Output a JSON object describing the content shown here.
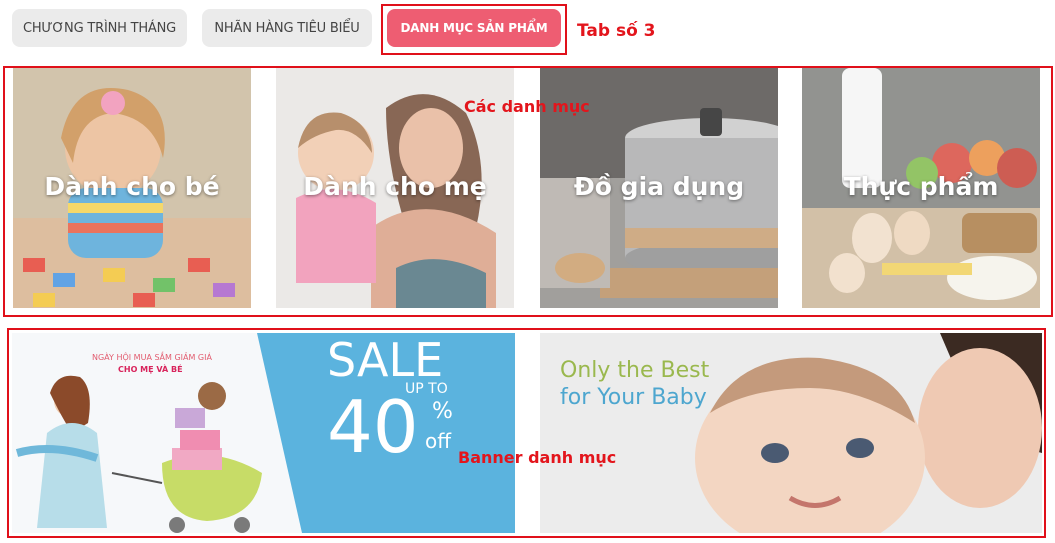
{
  "tabs": [
    {
      "label": "CHƯƠNG TRÌNH THÁNG"
    },
    {
      "label": "NHÃN HÀNG TIÊU BIỂU"
    },
    {
      "label": "DANH MỤC SẢN PHẨM"
    }
  ],
  "annotations": {
    "tab": "Tab số 3",
    "categories": "Các danh mục",
    "banners": "Banner danh mục"
  },
  "categories": [
    {
      "label": "Dành cho bé"
    },
    {
      "label": "Dành cho mẹ"
    },
    {
      "label": "Đồ gia dụng"
    },
    {
      "label": "Thực phẩm"
    }
  ],
  "banner_sale": {
    "event_line": "NGÀY HỘI MUA SẮM GIẢM GIÁ",
    "sub_line": "CHO MẸ VÀ BÉ",
    "sale": "SALE",
    "up_to": "UP TO",
    "amount": "40",
    "percent": "%",
    "off": "off"
  },
  "banner_baby": {
    "line1": "Only the Best",
    "line2": "for Your Baby"
  },
  "colors": {
    "accent": "#ee5d72",
    "annotation": "#e3151c",
    "sale_blue": "#5bb3de"
  }
}
